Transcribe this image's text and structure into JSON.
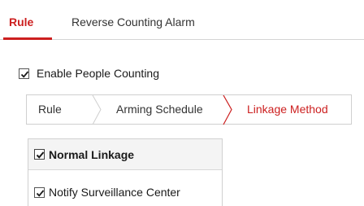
{
  "top_tabs": {
    "active": "Rule",
    "second": "Reverse Counting Alarm"
  },
  "enable": {
    "label": "Enable People Counting",
    "checked": true
  },
  "steps": {
    "items": [
      "Rule",
      "Arming Schedule",
      "Linkage Method"
    ],
    "active": "Linkage Method"
  },
  "linkage": {
    "header_label": "Normal Linkage",
    "header_checked": true,
    "items": [
      {
        "label": "Notify Surveillance Center",
        "checked": true
      }
    ]
  },
  "colors": {
    "accent": "#cc1f1f",
    "border": "#d0d0d0",
    "header_bg": "#f4f4f4"
  }
}
